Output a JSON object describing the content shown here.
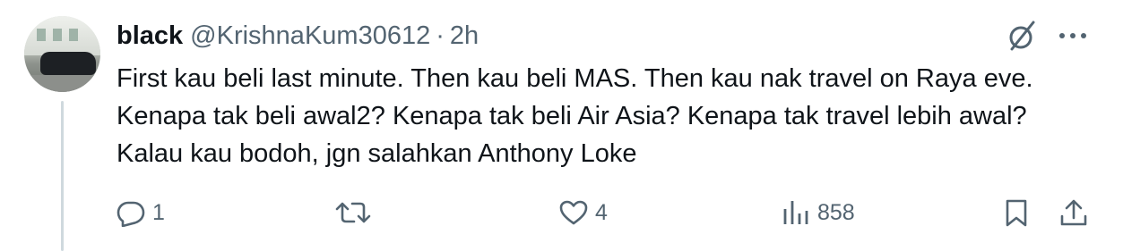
{
  "tweet": {
    "display_name": "black",
    "handle": "@KrishnaKum30612",
    "separator": "·",
    "time": "2h",
    "text": "First kau beli last minute. Then kau beli MAS. Then kau nak travel on Raya eve. Kenapa tak beli awal2? Kenapa tak beli Air Asia? Kenapa tak travel lebih awal? Kalau kau bodoh, jgn salahkan Anthony Loke"
  },
  "actions": {
    "reply_count": "1",
    "retweet_count": "",
    "like_count": "4",
    "view_count": "858"
  },
  "icons": {
    "header": [
      "grok-icon",
      "more-icon"
    ],
    "actions": [
      "reply-icon",
      "retweet-icon",
      "like-icon",
      "views-icon",
      "bookmark-icon",
      "share-icon"
    ]
  },
  "colors": {
    "text": "#0f1419",
    "secondary": "#536471",
    "thread_line": "#cfd9de"
  }
}
